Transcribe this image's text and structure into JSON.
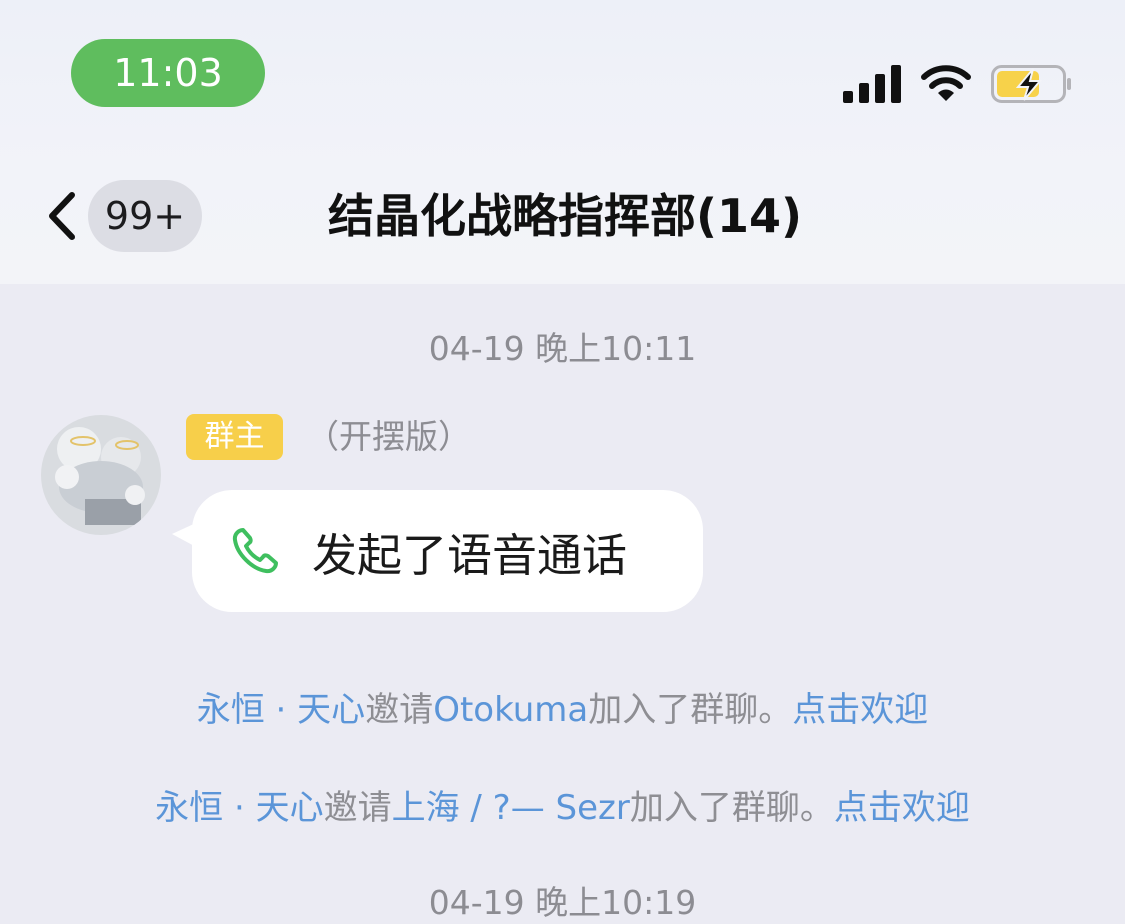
{
  "status_bar": {
    "time": "11:03",
    "icons": [
      "cellular-signal-icon",
      "wifi-icon",
      "battery-charging-icon"
    ]
  },
  "header": {
    "back_icon": "chevron-left-icon",
    "unread_count": "99+",
    "title": "结晶化战略指挥部(14)"
  },
  "messages": {
    "timestamp_1": "04-19 晚上10:11",
    "call_message": {
      "role_badge": "群主",
      "sender_name": "（开摆版）",
      "icon": "phone-icon",
      "text": "发起了语音通话"
    },
    "system_1": {
      "inviter": "永恒 · 天心",
      "verb": "邀请",
      "invitee": "Otokuma",
      "action": "加入了群聊。",
      "welcome": "点击欢迎"
    },
    "system_2": {
      "inviter": "永恒 · 天心",
      "verb": "邀请",
      "invitee": "上海 / ?— Sezr",
      "action": "加入了群聊。",
      "welcome": "点击欢迎"
    },
    "timestamp_2": "04-19 晚上10:19"
  },
  "colors": {
    "time_pill": "#5fbd5e",
    "role_badge": "#f7cf4a",
    "link": "#5b95d8",
    "phone_icon": "#3fbf5f",
    "battery": "#f7d24a"
  }
}
